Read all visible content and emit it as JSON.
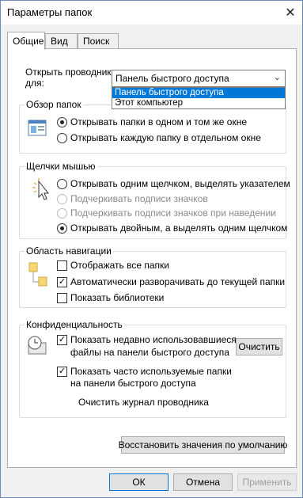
{
  "window": {
    "title": "Параметры папок"
  },
  "tabs": [
    {
      "label": "Общие",
      "active": true
    },
    {
      "label": "Вид",
      "active": false
    },
    {
      "label": "Поиск",
      "active": false
    }
  ],
  "open_explorer": {
    "label_line1": "Открыть проводник",
    "label_line2": "для:",
    "selected": "Панель быстрого доступа",
    "options": [
      "Панель быстрого доступа",
      "Этот компьютер"
    ]
  },
  "browse": {
    "title": "Обзор папок",
    "options": [
      {
        "label": "Открывать папки в одном и том же окне",
        "checked": true
      },
      {
        "label": "Открывать каждую папку в отдельном окне",
        "checked": false
      }
    ]
  },
  "clicks": {
    "title": "Щелчки мышью",
    "single_click": "Открывать одним щелчком, выделять указателем",
    "underline_always": "Подчеркивать подписи значков",
    "underline_hover": "Подчеркивать подписи значков при наведении",
    "double_click": "Открывать двойным, а выделять одним щелчком"
  },
  "navigation": {
    "title": "Область навигации",
    "show_all": "Отображать все папки",
    "expand": "Автоматически разворачивать до текущей папки",
    "libraries": "Показать библиотеки"
  },
  "privacy": {
    "title": "Конфиденциальность",
    "recent_line1": "Показать недавно использовавшиеся",
    "recent_line2": "файлы на панели быстрого доступа",
    "frequent_line1": "Показать часто используемые папки",
    "frequent_line2": "на панели быстрого доступа",
    "clear_history": "Очистить журнал проводника",
    "clear_button": "Очистить"
  },
  "restore_button": "Восстановить значения по умолчанию",
  "footer": {
    "ok": "ОК",
    "cancel": "Отмена",
    "apply": "Применить"
  },
  "colors": {
    "accent": "#0078d7",
    "border": "#adadad",
    "dialog_bg": "#f0f0f0"
  }
}
